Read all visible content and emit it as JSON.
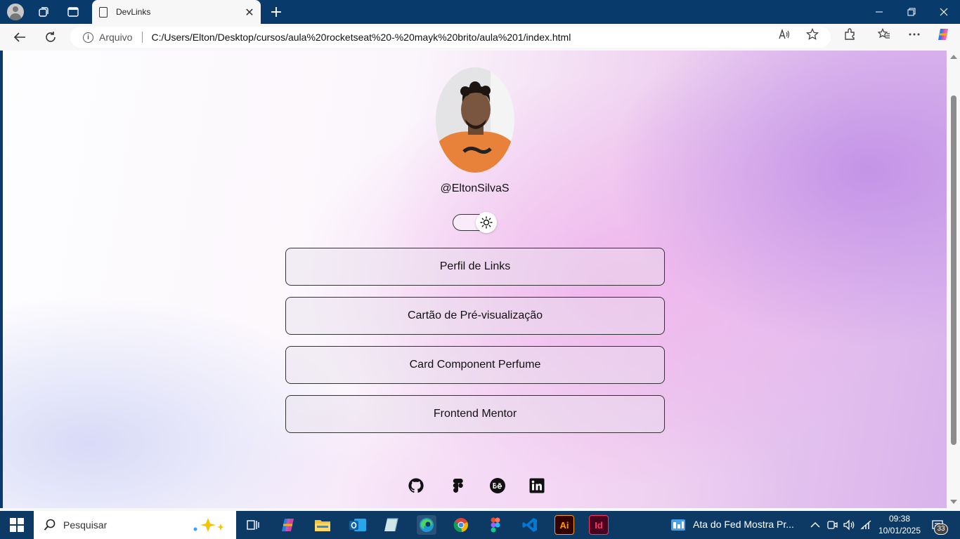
{
  "browser": {
    "tab_title": "DevLinks",
    "tab_close": "✕",
    "new_tab": "+",
    "address_scheme_label": "Arquivo",
    "address_url": "C:/Users/Elton/Desktop/cursos/aula%20rocketseat%20-%20mayk%20brito/aula%201/index.html",
    "icons": [
      "profile-icon",
      "workspaces-icon",
      "tab-actions-icon",
      "document-icon",
      "back-icon",
      "refresh-icon",
      "info-icon",
      "read-aloud-icon",
      "favorite-star-icon",
      "extensions-icon",
      "favorites-icon",
      "more-icon",
      "copilot-icon"
    ]
  },
  "page": {
    "handle": "@EltonSilvaS",
    "theme_switch": {
      "mode": "light",
      "icon": "sun-icon"
    },
    "links": [
      {
        "label": "Perfil de Links"
      },
      {
        "label": "Cartão de Pré-visualização"
      },
      {
        "label": "Card Component Perfume"
      },
      {
        "label": "Frontend Mentor"
      }
    ],
    "socials": [
      "github-icon",
      "figma-icon",
      "behance-icon",
      "linkedin-icon"
    ]
  },
  "taskbar": {
    "search_placeholder": "Pesquisar",
    "pinned_apps": [
      "task-view",
      "copilot",
      "file-explorer",
      "outlook",
      "notes",
      "edge",
      "chrome",
      "figma",
      "vscode",
      "illustrator",
      "indesign"
    ],
    "illustrator_label": "Ai",
    "indesign_label": "Id",
    "active_window_title": "Ata do Fed Mostra Pr...",
    "time": "09:38",
    "date": "10/01/2025",
    "notification_count": "33"
  },
  "colors": {
    "titlebar": "#083a6b",
    "taskbar": "#0d3a64",
    "page_gradient_end": "#d9b3ec",
    "illustrator": "#ff9a00",
    "indesign": "#ff3366",
    "vscode": "#0078d4"
  }
}
